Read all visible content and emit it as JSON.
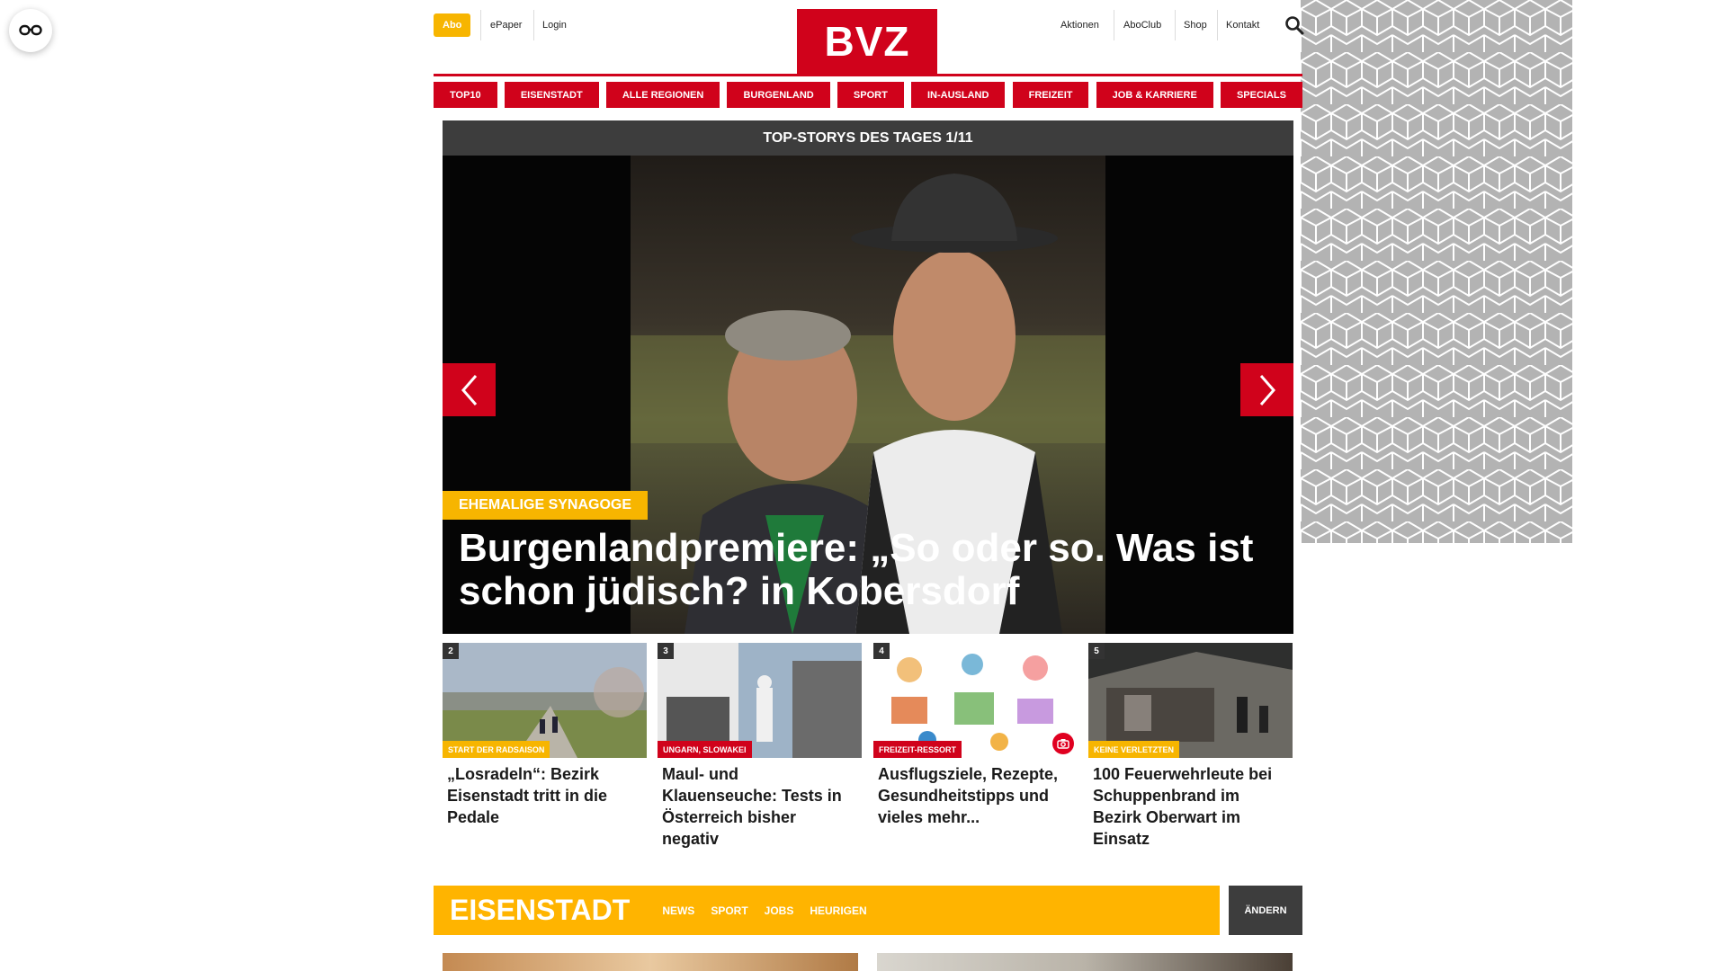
{
  "accessibility": {
    "icon": "glasses-icon"
  },
  "header": {
    "abo": "Abo",
    "epaper": "ePaper",
    "login": "Login",
    "logo": "BVZ",
    "right_links": [
      "Aktionen",
      "AboClub",
      "Shop",
      "Kontakt"
    ],
    "search_icon": "search-icon"
  },
  "nav": [
    "TOP10",
    "EISENSTADT",
    "ALLE REGIONEN",
    "BURGENLAND",
    "SPORT",
    "IN-AUSLAND",
    "FREIZEIT",
    "JOB & KARRIERE",
    "SPECIALS"
  ],
  "carousel": {
    "header": "TOP-STORYS DES TAGES 1/11",
    "badge": "EHEMALIGE SYNAGOGE",
    "title": "Burgenlandpremiere: „So oder so. Was ist schon jüdisch? in Kobersdorf",
    "prev_icon": "chevron-left-icon",
    "next_icon": "chevron-right-icon"
  },
  "teasers": [
    {
      "num": "2",
      "tag": "START DER RADSAISON",
      "tag_color": "#f7b500",
      "title": "„Losradeln“: Bezirk Eisenstadt tritt in die Pedale"
    },
    {
      "num": "3",
      "tag": "UNGARN, SLOWAKEI",
      "tag_color": "#d0021b",
      "title": "Maul- und Klauenseuche: Tests in Österreich bisher negativ"
    },
    {
      "num": "4",
      "tag": "FREIZEIT-RESSORT",
      "tag_color": "#d0021b",
      "title": "Ausflugsziele, Rezepte, Gesundheitstipps und vieles mehr..."
    },
    {
      "num": "5",
      "tag": "KEINE VERLETZTEN",
      "tag_color": "#f7b500",
      "title": "100 Feuerwehrleute bei Schuppenbrand im Bezirk Oberwart im Einsatz"
    }
  ],
  "region": {
    "title": "EISENSTADT",
    "links": [
      "NEWS",
      "SPORT",
      "JOBS",
      "HEURIGEN"
    ],
    "change": "ÄNDERN"
  },
  "colors": {
    "brand_red": "#d0021b",
    "accent_yellow": "#f7b500",
    "dark": "#3d3d3d"
  }
}
